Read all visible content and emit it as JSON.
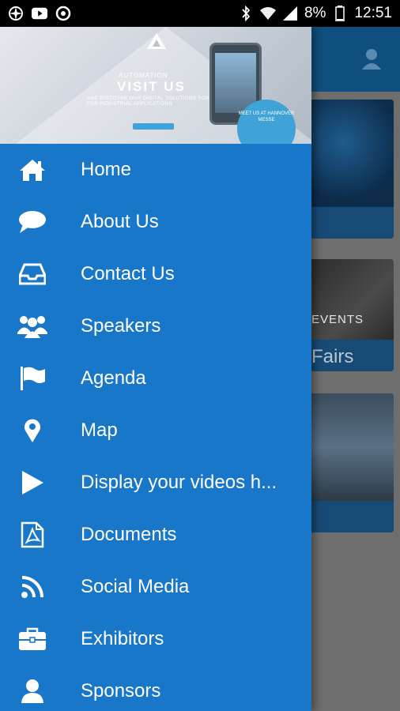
{
  "status_bar": {
    "battery": "8%",
    "time": "12:51",
    "left_icons": [
      "pinwheel-icon",
      "youtube-icon",
      "circle-app-icon"
    ],
    "right_icons": [
      "bluetooth-icon",
      "wifi-icon",
      "signal-icon",
      "battery-icon"
    ]
  },
  "drawer": {
    "header_banner": {
      "kicker": "AUTOMATION",
      "headline": "VISIT US",
      "tagline": "AND DISCOVER OUR DIGITAL SOLUTIONS PORTFOLIO FOR INDUSTRIAL APPLICATIONS",
      "badge": "MEET US AT HANNOVER MESSE",
      "brand_mark": "triangle-logo"
    },
    "items": [
      {
        "label": "Home",
        "icon": "home-icon"
      },
      {
        "label": "About Us",
        "icon": "chat-bubble-icon"
      },
      {
        "label": "Contact Us",
        "icon": "inbox-icon"
      },
      {
        "label": "Speakers",
        "icon": "group-icon"
      },
      {
        "label": "Agenda",
        "icon": "flag-icon"
      },
      {
        "label": "Map",
        "icon": "map-pin-icon"
      },
      {
        "label": "Display your videos h...",
        "icon": "play-icon"
      },
      {
        "label": "Documents",
        "icon": "pdf-icon"
      },
      {
        "label": "Social Media",
        "icon": "rss-icon"
      },
      {
        "label": "Exhibitors",
        "icon": "briefcase-icon"
      },
      {
        "label": "Sponsors",
        "icon": "person-icon"
      }
    ]
  },
  "background": {
    "header_icon": "user-icon",
    "card_labels": [
      "EVENTS",
      "Fairs"
    ]
  },
  "colors": {
    "drawer": "#1977c9",
    "header": "#0f4f7f",
    "scrim": "#6e6e6e"
  }
}
